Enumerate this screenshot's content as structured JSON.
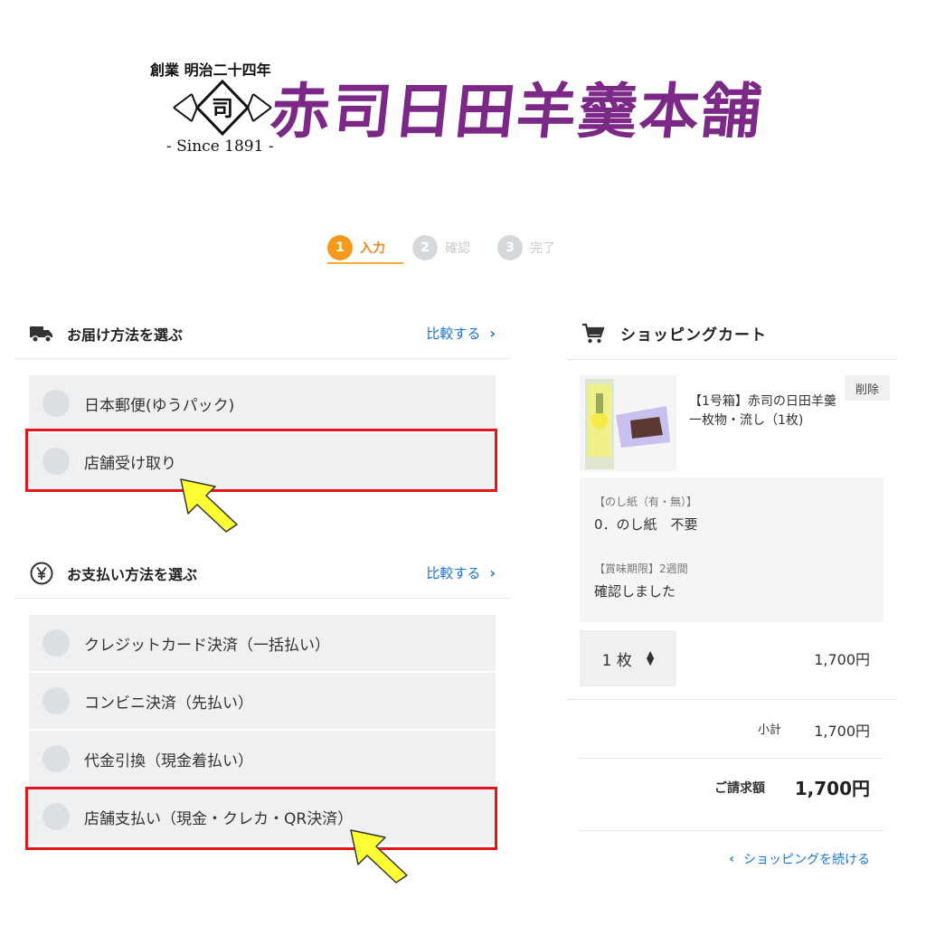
{
  "logo": {
    "founding": "創業 明治二十四年",
    "since": "- Since 1891 -",
    "name": "赤司日田羊羹本舗",
    "emblem_char": "司"
  },
  "steps": [
    {
      "num": "1",
      "label": "入力",
      "state": "active"
    },
    {
      "num": "2",
      "label": "確認",
      "state": "inactive"
    },
    {
      "num": "3",
      "label": "完了",
      "state": "inactive"
    }
  ],
  "delivery": {
    "title": "お届け方法を選ぶ",
    "compare": "比較する",
    "icon": "truck-icon",
    "options": [
      "日本郵便(ゆうパック)",
      "店舗受け取り"
    ]
  },
  "payment": {
    "title": "お支払い方法を選ぶ",
    "compare": "比較する",
    "icon": "yen-icon",
    "options": [
      "クレジットカード決済（一括払い）",
      "コンビニ決済（先払い）",
      "代金引換（現金着払い）",
      "店舗支払い（現金・クレカ・QR決済）"
    ]
  },
  "cart": {
    "title": "ショッピングカート",
    "icon": "cart-icon",
    "product_name": "【1号箱】赤司の日田羊羹　一枚物・流し（1枚)",
    "delete_label": "削除",
    "option1_key": "【のし紙（有・無）】",
    "option1_val": "0．のし紙　不要",
    "option2_key": "【賞味期限】2週間",
    "option2_val": "確認しました",
    "quantity": "1 枚",
    "line_price": "1,700円",
    "subtotal_label": "小計",
    "subtotal_value": "1,700円",
    "total_label": "ご請求額",
    "total_value": "1,700円",
    "continue_label": "ショッピングを続ける"
  },
  "colors": {
    "accent_orange": "#f59a1d",
    "link_blue": "#1a73d9",
    "highlight_red": "#e8141b",
    "brand_purple": "#7b2886",
    "arrow_yellow": "#ffff33"
  }
}
